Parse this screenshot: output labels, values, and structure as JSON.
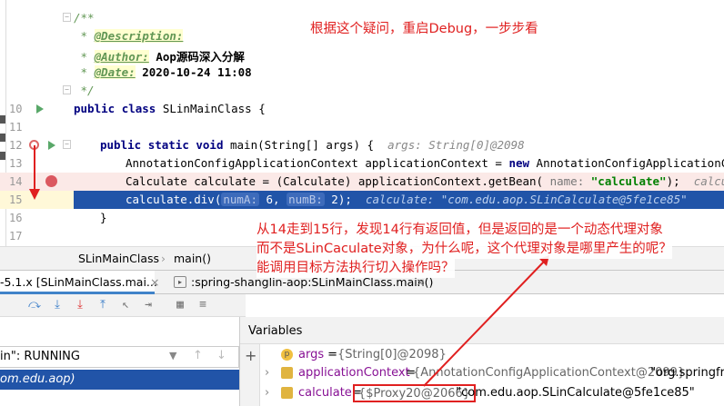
{
  "editor": {
    "lines": [
      {
        "num": "",
        "doc_open": "/**"
      },
      {
        "num": "",
        "doc_prefix": " * ",
        "tag": "@Description:",
        "text": ""
      },
      {
        "num": "",
        "doc_prefix": " * ",
        "tag": "@Author:",
        "text": " Aop源码深入分解"
      },
      {
        "num": "",
        "doc_prefix": " * ",
        "tag": "@Date:",
        "text": " 2020-10-24 11:08"
      },
      {
        "num": "",
        "doc_close": " */"
      },
      {
        "num": "10",
        "kw1": "public",
        "kw2": "class",
        "rest": " SLinMainClass {"
      },
      {
        "num": "11"
      },
      {
        "num": "12",
        "kw1": "public",
        "kw2": "static",
        "kw3": "void",
        "rest": " main(String[] args) {",
        "hint": "args: String[0]@2098"
      },
      {
        "num": "13",
        "part1": "AnnotationConfigApplicationContext applicationContext = ",
        "kw": "new",
        "part2": " AnnotationConfigApplicationContext"
      },
      {
        "num": "14",
        "part1": "Calculate calculate = (Calculate) applicationContext.getBean(",
        "param": "name:",
        "str": "\"calculate\"",
        "part2": ");",
        "hint": "calculate:"
      },
      {
        "num": "15",
        "part1": "calculate.div(",
        "p1": "numA:",
        "v1": "6,",
        "p2": "numB:",
        "v2": "2);",
        "hint": "calculate: \"com.edu.aop.SLinCalculate@5fe1ce85\""
      },
      {
        "num": "16",
        "rest": "}"
      },
      {
        "num": "17"
      }
    ],
    "annotation_top": "根据这个疑问，重启Debug，一步步看",
    "annotation_bottom": [
      "从14走到15行，发现14行有返回值，但是返回的是一个动态代理对象",
      "而不是SLinCaculate对象，为什么呢，这个代理对象是哪里产生的呢？",
      "能调用目标方法执行切入操作吗？"
    ]
  },
  "breadcrumb": {
    "class": "SLinMainClass",
    "method": "main()"
  },
  "tabs": {
    "left": "-5.1.x [SLinMainClass.mai...",
    "right": ":spring-shanglin-aop:SLinMainClass.main()"
  },
  "frames": {
    "thread": "in\": RUNNING",
    "frame": "om.edu.aop)"
  },
  "variables": {
    "header": "Variables",
    "items": [
      {
        "icon": "p",
        "name": "args",
        "eq": " = ",
        "value": "{String[0]@2098}",
        "extra": ""
      },
      {
        "icon": "f",
        "name": "applicationContext",
        "eq": " = ",
        "value": "{AnnotationConfigApplicationContext@2099}",
        "extra": " \"org.springfra"
      },
      {
        "icon": "f",
        "name": "calculate",
        "eq": " = ",
        "value": "{$Proxy20@2066}",
        "extra": " \"com.edu.aop.SLinCalculate@5fe1ce85\""
      }
    ]
  },
  "colors": {
    "highlight": "#2154a8",
    "error_line": "#fbe9e7",
    "annotation": "#e02020"
  }
}
